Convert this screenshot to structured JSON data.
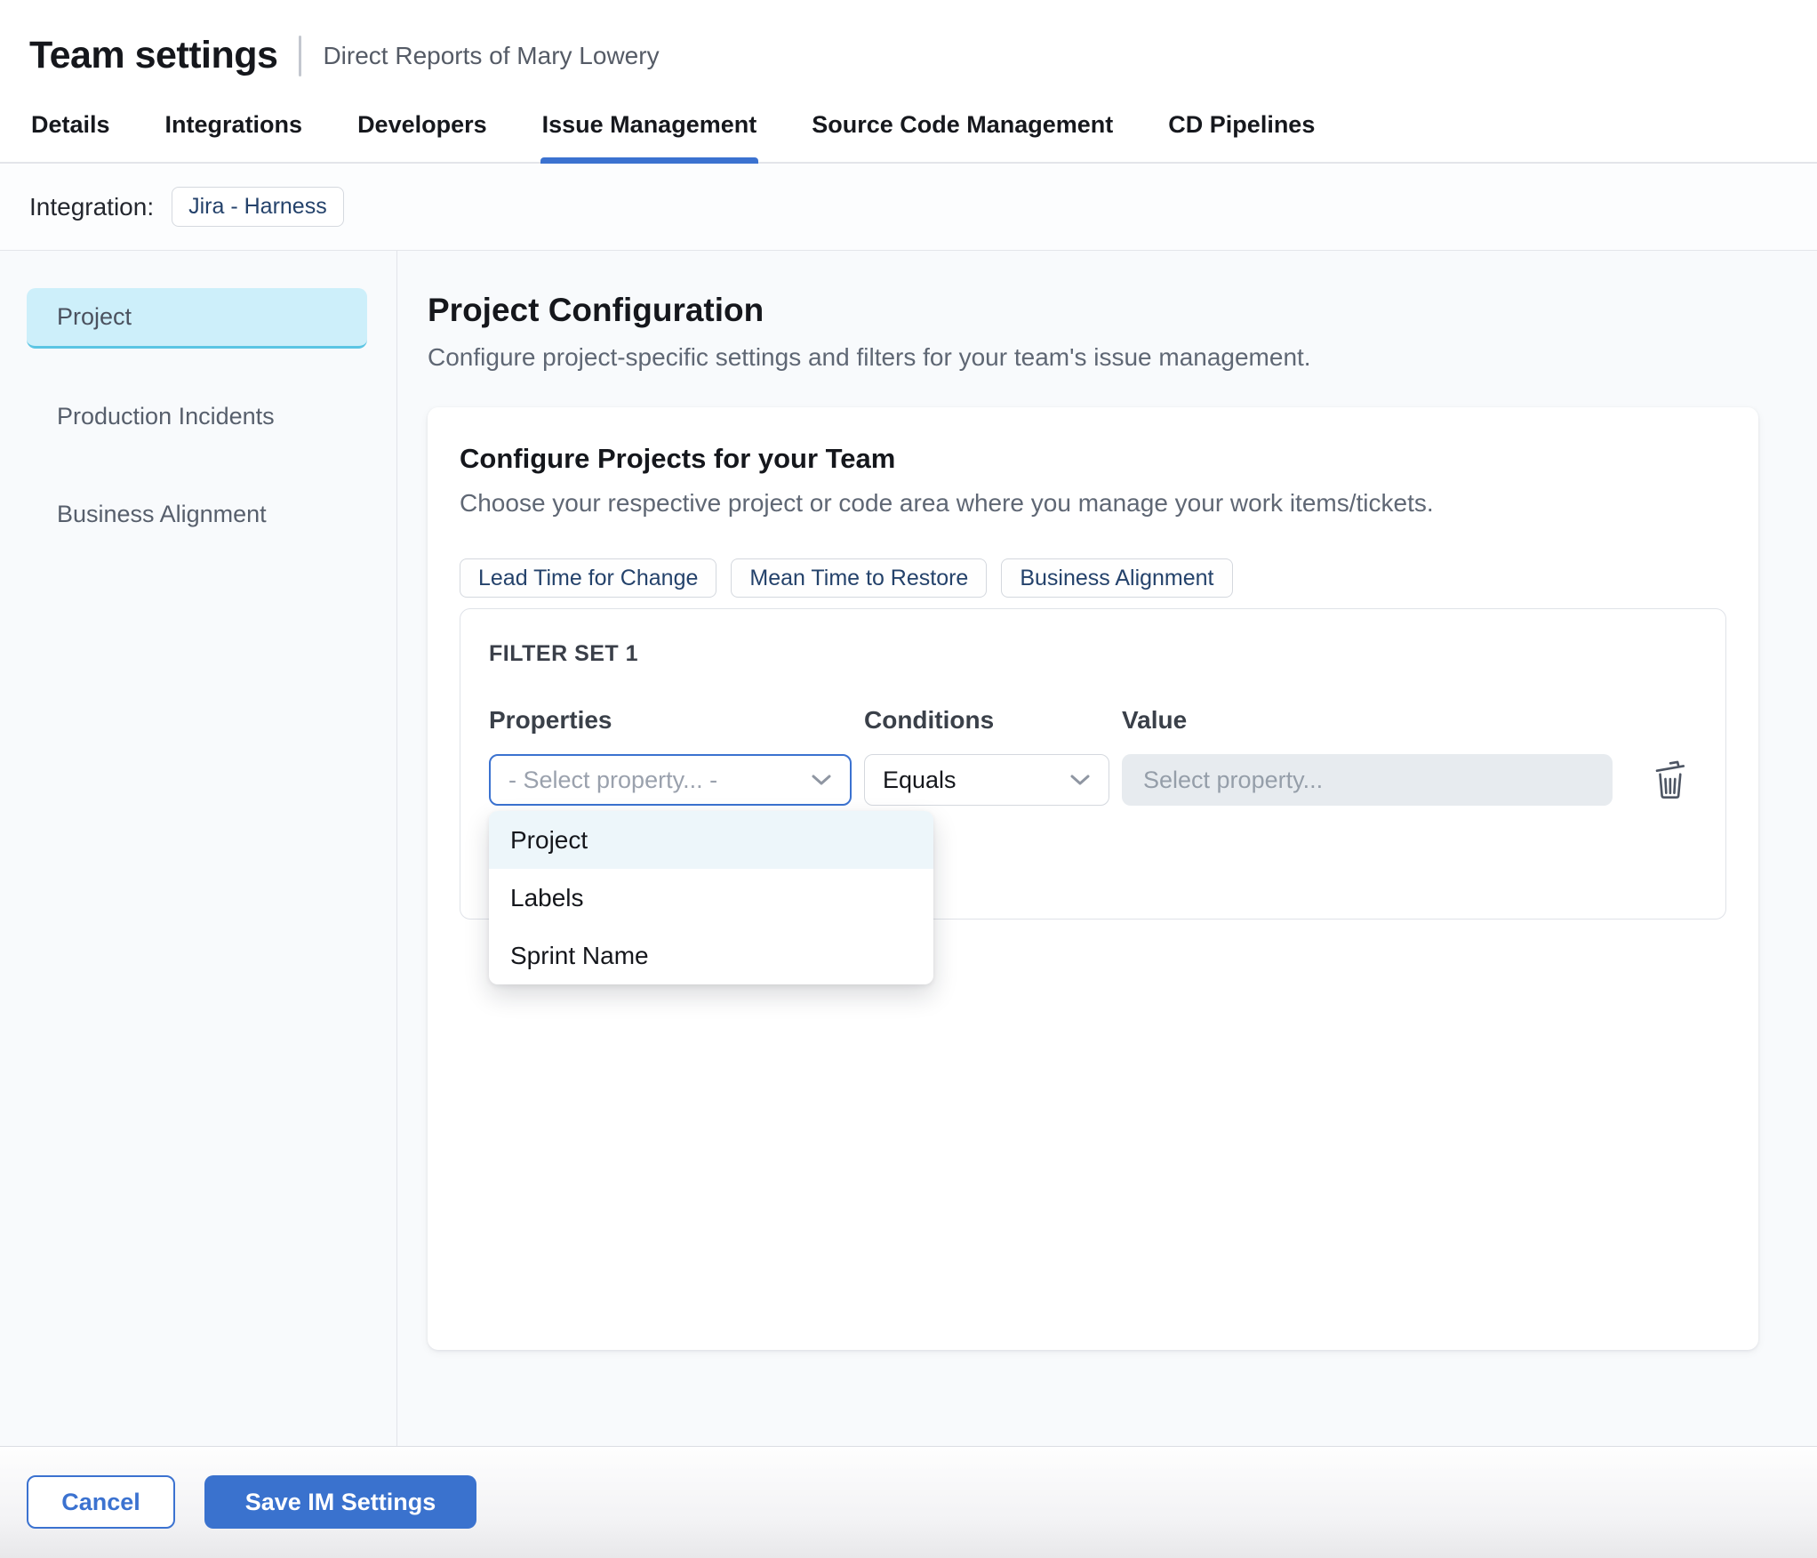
{
  "header": {
    "title": "Team settings",
    "subtitle": "Direct Reports of Mary Lowery"
  },
  "tabs": {
    "items": [
      "Details",
      "Integrations",
      "Developers",
      "Issue Management",
      "Source Code Management",
      "CD Pipelines"
    ],
    "active": "Issue Management"
  },
  "integration": {
    "label": "Integration:",
    "value": "Jira - Harness"
  },
  "sidebar": {
    "items": [
      {
        "label": "Project",
        "active": true
      },
      {
        "label": "Production Incidents",
        "active": false
      },
      {
        "label": "Business Alignment",
        "active": false
      }
    ]
  },
  "main": {
    "title": "Project Configuration",
    "description": "Configure project-specific settings and filters for your team's issue management."
  },
  "card": {
    "title": "Configure Projects for your Team",
    "description": "Choose your respective project or code area where you manage your work items/tickets.",
    "chips": [
      "Lead Time for Change",
      "Mean Time to Restore",
      "Business Alignment"
    ]
  },
  "filter_set": {
    "title": "FILTER SET 1",
    "columns": {
      "properties": "Properties",
      "conditions": "Conditions",
      "value": "Value"
    },
    "property_select": {
      "placeholder": "- Select property... -"
    },
    "condition_select": {
      "value": "Equals"
    },
    "value_input": {
      "placeholder": "Select property..."
    },
    "icons": [
      "chevron-down-icon",
      "trash-icon"
    ]
  },
  "dropdown": {
    "options": [
      "Project",
      "Labels",
      "Sprint Name"
    ],
    "highlighted": "Project"
  },
  "footer": {
    "cancel_label": "Cancel",
    "save_label": "Save IM Settings"
  },
  "colors": {
    "accent_blue": "#3B72D0",
    "save_button_bg": "#3A72CE",
    "tab_underline": "#3B72D0",
    "active_sidebar_bg": "#CDEFFA",
    "active_sidebar_border": "#5BC5E3",
    "chip_text_navy": "#24426B",
    "dropdown_highlight_bg": "#EDF6FA",
    "disabled_input_bg": "#E7EBEF",
    "content_bg": "#F8FAFC"
  }
}
